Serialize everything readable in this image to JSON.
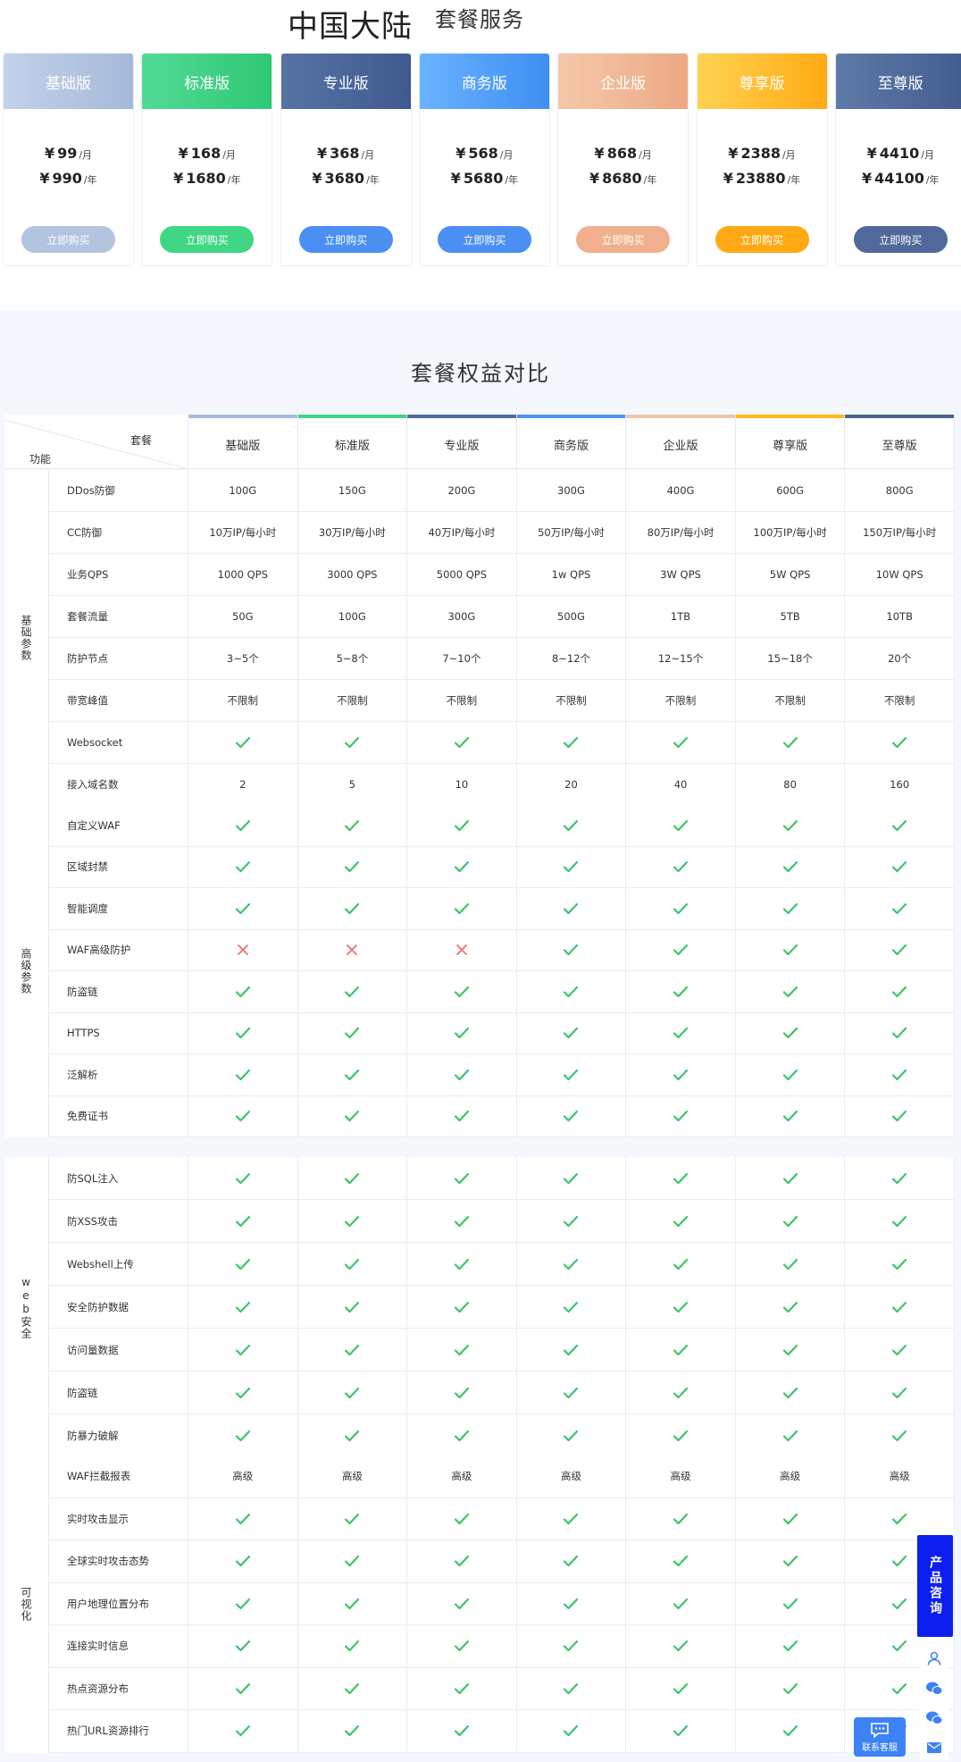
{
  "header": {
    "title_main": "中国大陆",
    "title_sub": "套餐服务"
  },
  "plans": [
    {
      "name": "基础版",
      "monthly": "99",
      "yearly": "990",
      "buy_label": "立即购买",
      "head_from": "#c3d2ea",
      "head_to": "#a6b8da",
      "btn_color": "#b3c4e0",
      "bar_color": "#a8bce0"
    },
    {
      "name": "标准版",
      "monthly": "168",
      "yearly": "1680",
      "buy_label": "立即购买",
      "head_from": "#52da95",
      "head_to": "#2ec874",
      "btn_color": "#3fd684",
      "bar_color": "#44d18a"
    },
    {
      "name": "专业版",
      "monthly": "368",
      "yearly": "3680",
      "buy_label": "立即购买",
      "head_from": "#5673a6",
      "head_to": "#3e5a8e",
      "btn_color": "#4b8ff3",
      "bar_color": "#4f6d9f"
    },
    {
      "name": "商务版",
      "monthly": "568",
      "yearly": "5680",
      "buy_label": "立即购买",
      "head_from": "#6ab3ff",
      "head_to": "#3e8ef3",
      "btn_color": "#4b8ff3",
      "bar_color": "#4a94f5"
    },
    {
      "name": "企业版",
      "monthly": "868",
      "yearly": "8680",
      "buy_label": "立即购买",
      "head_from": "#f5c8aa",
      "head_to": "#eca882",
      "btn_color": "#f0b08e",
      "bar_color": "#f0c5a7"
    },
    {
      "name": "尊享版",
      "monthly": "2388",
      "yearly": "23880",
      "buy_label": "立即购买",
      "head_from": "#ffd250",
      "head_to": "#ffaa14",
      "btn_color": "#ffaa14",
      "bar_color": "#ffb81c"
    },
    {
      "name": "至尊版",
      "monthly": "4410",
      "yearly": "44100",
      "buy_label": "立即购买",
      "head_from": "#5e7aa8",
      "head_to": "#405d8f",
      "btn_color": "#50699a",
      "bar_color": "#4b648f"
    }
  ],
  "currency": "¥",
  "unit_month": "/月",
  "unit_year": "/年",
  "comparison": {
    "title": "套餐权益对比",
    "header_plan": "套餐",
    "header_feature": "功能",
    "groups": [
      {
        "label": "基础参数",
        "rows": [
          {
            "feature": "DDos防御",
            "values": [
              "100G",
              "150G",
              "200G",
              "300G",
              "400G",
              "600G",
              "800G"
            ]
          },
          {
            "feature": "CC防御",
            "values": [
              "10万IP/每小时",
              "30万IP/每小时",
              "40万IP/每小时",
              "50万IP/每小时",
              "80万IP/每小时",
              "100万IP/每小时",
              "150万IP/每小时"
            ]
          },
          {
            "feature": "业务QPS",
            "values": [
              "1000 QPS",
              "3000 QPS",
              "5000 QPS",
              "1w QPS",
              "3W QPS",
              "5W QPS",
              "10W QPS"
            ]
          },
          {
            "feature": "套餐流量",
            "values": [
              "50G",
              "100G",
              "300G",
              "500G",
              "1TB",
              "5TB",
              "10TB"
            ]
          },
          {
            "feature": "防护节点",
            "values": [
              "3~5个",
              "5~8个",
              "7~10个",
              "8~12个",
              "12~15个",
              "15~18个",
              "20个"
            ]
          },
          {
            "feature": "带宽峰值",
            "values": [
              "不限制",
              "不限制",
              "不限制",
              "不限制",
              "不限制",
              "不限制",
              "不限制"
            ]
          },
          {
            "feature": "Websocket",
            "values": [
              "check",
              "check",
              "check",
              "check",
              "check",
              "check",
              "check"
            ]
          },
          {
            "feature": "接入域名数",
            "values": [
              "2",
              "5",
              "10",
              "20",
              "40",
              "80",
              "160"
            ]
          }
        ]
      },
      {
        "label": "高级参数",
        "rows": [
          {
            "feature": "自定义WAF",
            "values": [
              "check",
              "check",
              "check",
              "check",
              "check",
              "check",
              "check"
            ]
          },
          {
            "feature": "区域封禁",
            "values": [
              "check",
              "check",
              "check",
              "check",
              "check",
              "check",
              "check"
            ]
          },
          {
            "feature": "智能调度",
            "values": [
              "check",
              "check",
              "check",
              "check",
              "check",
              "check",
              "check"
            ]
          },
          {
            "feature": "WAF高级防护",
            "values": [
              "cross",
              "cross",
              "cross",
              "check",
              "check",
              "check",
              "check"
            ]
          },
          {
            "feature": "防盗链",
            "values": [
              "check",
              "check",
              "check",
              "check",
              "check",
              "check",
              "check"
            ]
          },
          {
            "feature": "HTTPS",
            "values": [
              "check",
              "check",
              "check",
              "check",
              "check",
              "check",
              "check"
            ]
          },
          {
            "feature": "泛解析",
            "values": [
              "check",
              "check",
              "check",
              "check",
              "check",
              "check",
              "check"
            ]
          },
          {
            "feature": "免费证书",
            "values": [
              "check",
              "check",
              "check",
              "check",
              "check",
              "check",
              "check"
            ]
          }
        ]
      },
      {
        "label": "web安全",
        "rows": [
          {
            "feature": "防SQL注入",
            "values": [
              "check",
              "check",
              "check",
              "check",
              "check",
              "check",
              "check"
            ]
          },
          {
            "feature": "防XSS攻击",
            "values": [
              "check",
              "check",
              "check",
              "check",
              "check",
              "check",
              "check"
            ]
          },
          {
            "feature": "Webshell上传",
            "values": [
              "check",
              "check",
              "check",
              "check",
              "check",
              "check",
              "check"
            ]
          },
          {
            "feature": "安全防护数据",
            "values": [
              "check",
              "check",
              "check",
              "check",
              "check",
              "check",
              "check"
            ]
          },
          {
            "feature": "访问量数据",
            "values": [
              "check",
              "check",
              "check",
              "check",
              "check",
              "check",
              "check"
            ]
          },
          {
            "feature": "防盗链",
            "values": [
              "check",
              "check",
              "check",
              "check",
              "check",
              "check",
              "check"
            ]
          },
          {
            "feature": "防暴力破解",
            "values": [
              "check",
              "check",
              "check",
              "check",
              "check",
              "check",
              "check"
            ]
          }
        ]
      },
      {
        "label": "可视化",
        "rows": [
          {
            "feature": "WAF拦截报表",
            "values": [
              "高级",
              "高级",
              "高级",
              "高级",
              "高级",
              "高级",
              "高级"
            ]
          },
          {
            "feature": "实时攻击显示",
            "values": [
              "check",
              "check",
              "check",
              "check",
              "check",
              "check",
              "check"
            ]
          },
          {
            "feature": "全球实时攻击态势",
            "values": [
              "check",
              "check",
              "check",
              "check",
              "check",
              "check",
              "check"
            ]
          },
          {
            "feature": "用户地理位置分布",
            "values": [
              "check",
              "check",
              "check",
              "check",
              "check",
              "check",
              "check"
            ]
          },
          {
            "feature": "连接实时信息",
            "values": [
              "check",
              "check",
              "check",
              "check",
              "check",
              "check",
              "check"
            ]
          },
          {
            "feature": "热点资源分布",
            "values": [
              "check",
              "check",
              "check",
              "check",
              "check",
              "check",
              "check"
            ]
          },
          {
            "feature": "热门URL资源排行",
            "values": [
              "check",
              "check",
              "check",
              "check",
              "check",
              "check",
              "check"
            ]
          }
        ]
      }
    ]
  },
  "widgets": {
    "consult_label": "产品咨询",
    "service_label": "联系客服",
    "icons": [
      "user-icon",
      "wechat-icon",
      "wechat-icon",
      "mail-icon"
    ]
  },
  "colors": {
    "check": "#3cc46a",
    "cross": "#f0706f",
    "consult": "#0d1fef",
    "service": "#3d82f4"
  }
}
